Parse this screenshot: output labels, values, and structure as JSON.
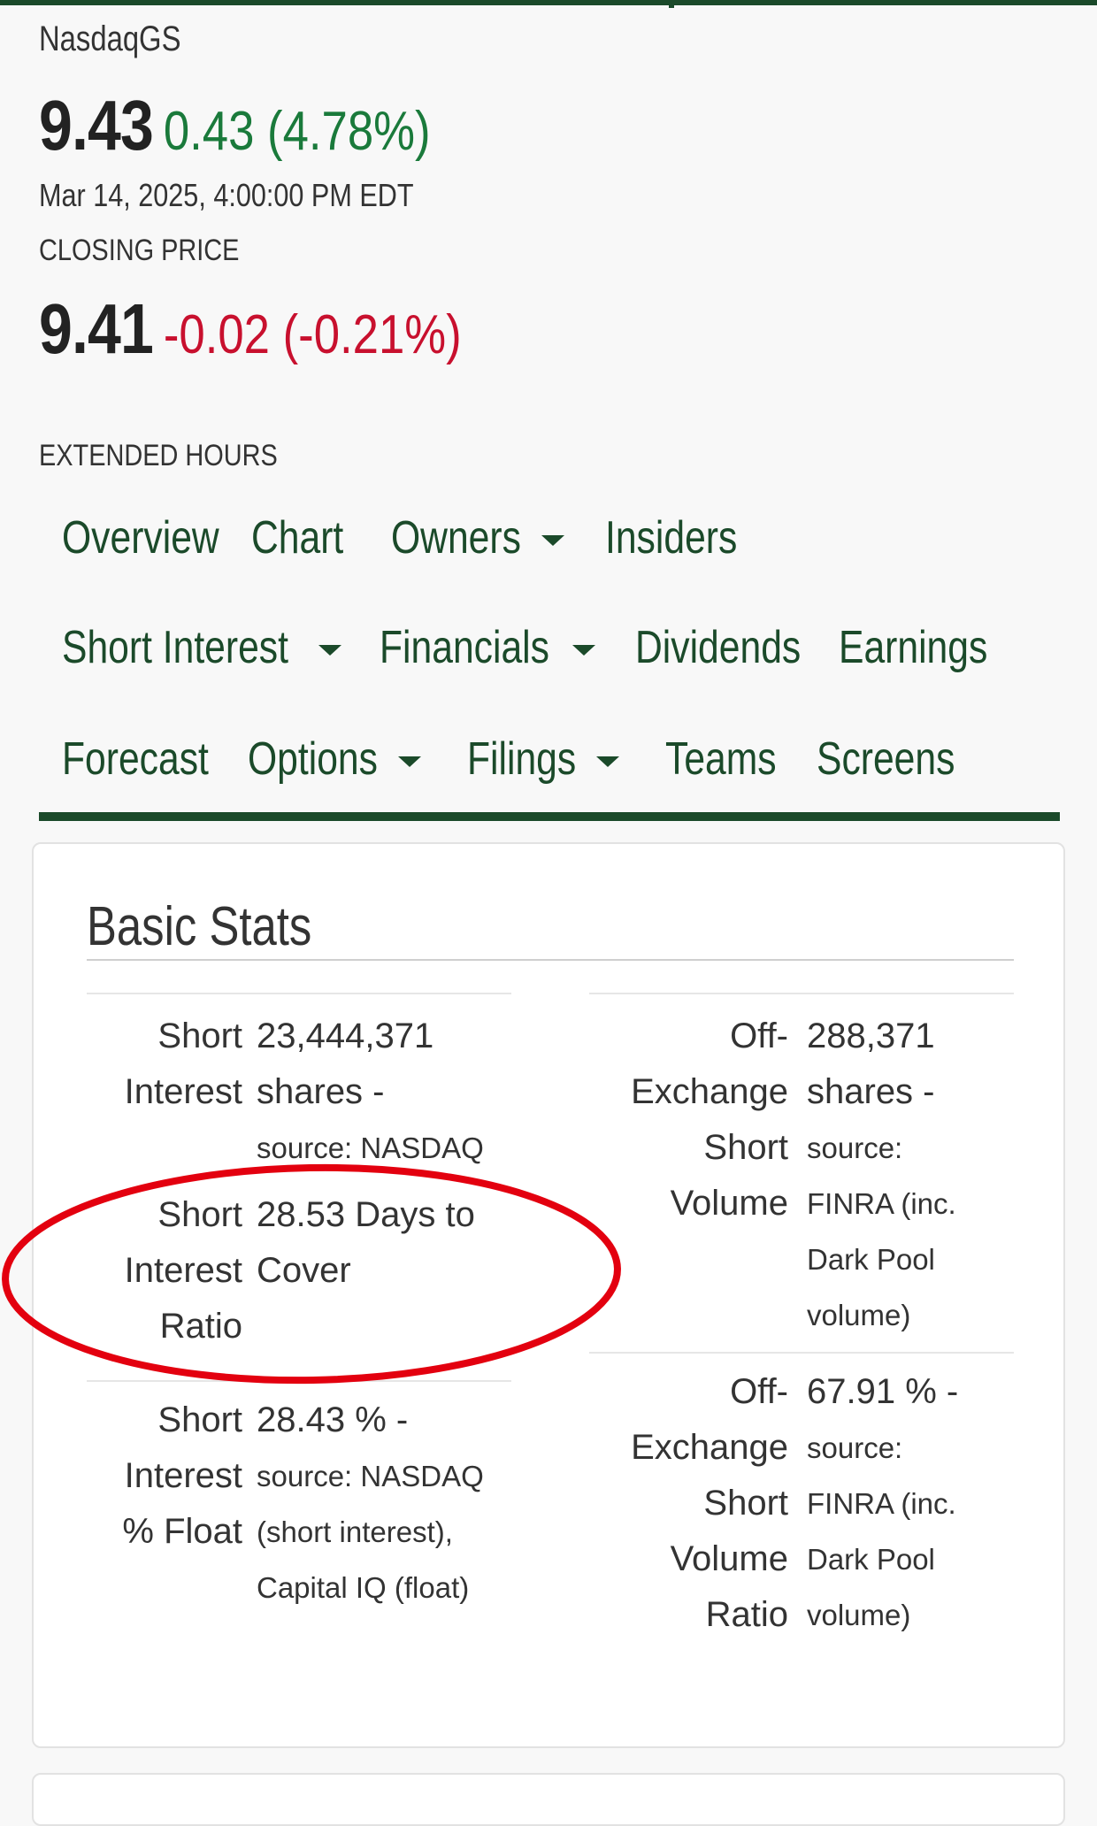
{
  "quote": {
    "exchange": "NasdaqGS",
    "price": "9.43",
    "change": "0.43 (4.78%)",
    "timestamp": "Mar 14, 2025, 4:00:00 PM EDT",
    "closing_label": "CLOSING PRICE",
    "extended_price": "9.41",
    "extended_change": "-0.02 (-0.21%)",
    "extended_label": "EXTENDED HOURS"
  },
  "nav": {
    "row1": [
      {
        "label": "Overview",
        "dropdown": false
      },
      {
        "label": "Chart",
        "dropdown": false
      },
      {
        "label": "Owners",
        "dropdown": true
      },
      {
        "label": "Insiders",
        "dropdown": false
      }
    ],
    "row2": [
      {
        "label": "Short Interest",
        "dropdown": true
      },
      {
        "label": "Financials",
        "dropdown": true
      },
      {
        "label": "Dividends",
        "dropdown": false
      },
      {
        "label": "Earnings",
        "dropdown": false
      }
    ],
    "row3": [
      {
        "label": "Forecast",
        "dropdown": false
      },
      {
        "label": "Options",
        "dropdown": true
      },
      {
        "label": "Filings",
        "dropdown": true
      },
      {
        "label": "Teams",
        "dropdown": false
      },
      {
        "label": "Screens",
        "dropdown": false
      }
    ]
  },
  "basic_stats": {
    "title": "Basic Stats",
    "left": [
      {
        "label_lines": [
          "Short",
          "Interest"
        ],
        "value_lines": [
          "23,444,371",
          "shares -"
        ],
        "source_lines": [
          "source: NASDAQ"
        ]
      },
      {
        "label_lines": [
          "Short",
          "Interest",
          "Ratio"
        ],
        "value_lines": [
          "28.53 Days to",
          "Cover"
        ],
        "source_lines": []
      },
      {
        "label_lines": [
          "Short",
          "Interest",
          "% Float"
        ],
        "value_lines": [
          "28.43 % -"
        ],
        "source_lines": [
          "source: NASDAQ",
          "(short interest),",
          "Capital IQ (float)"
        ]
      }
    ],
    "right": [
      {
        "label_lines": [
          "Off-",
          "Exchange",
          "Short",
          "Volume"
        ],
        "value_lines": [
          "288,371",
          "shares -"
        ],
        "source_lines": [
          "source:",
          "FINRA (inc.",
          "Dark Pool",
          "volume)"
        ]
      },
      {
        "label_lines": [
          "Off-",
          "Exchange",
          "Short",
          "Volume",
          "Ratio"
        ],
        "value_lines": [
          "67.91 % -"
        ],
        "source_lines": [
          "source:",
          "FINRA (inc.",
          "Dark Pool",
          "volume)"
        ]
      }
    ]
  },
  "colors": {
    "brand_green": "#1b4a2a",
    "up_green": "#1a7a3b",
    "down_red": "#c8102e",
    "annotation_red": "#e3000f"
  }
}
